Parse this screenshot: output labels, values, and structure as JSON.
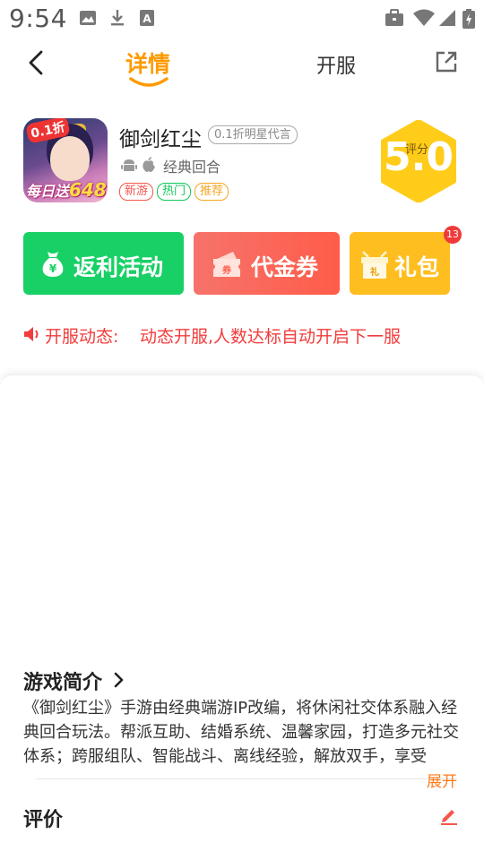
{
  "status_bar": {
    "time": "9:54"
  },
  "header": {
    "tabs": [
      {
        "label": "详情",
        "active": true
      },
      {
        "label": "开服",
        "active": false
      }
    ]
  },
  "game": {
    "title": "御剑红尘",
    "discount": "0.1折明星代言",
    "genre": "经典回合",
    "icon_badge": "0.1折",
    "icon_caption": "每日送",
    "icon_caption_num": "648",
    "tags": [
      "新游",
      "热门",
      "推荐"
    ],
    "score": "5.0",
    "score_label": "评分"
  },
  "actions": {
    "rebate": "返利活动",
    "voucher": "代金券",
    "gift": "礼包",
    "gift_count": "13"
  },
  "server_news": {
    "label": "开服动态:",
    "text": "动态开服,人数达标自动开启下一服"
  },
  "intro": {
    "title": "游戏简介",
    "text": "《御剑红尘》手游由经典端游IP改编，将休闲社交体系融入经典回合玩法。帮派互助、结婚系统、温馨家园，打造多元社交体系；跨服组队、智能战斗、离线经验，解放双手，享受",
    "expand": "展开"
  },
  "review": {
    "title": "评价"
  },
  "colors": {
    "accent": "#ff9a00",
    "rebate": "#19d066",
    "voucher": "#ff5c4a",
    "gift": "#ffbe1f",
    "news": "#f23c3c"
  }
}
